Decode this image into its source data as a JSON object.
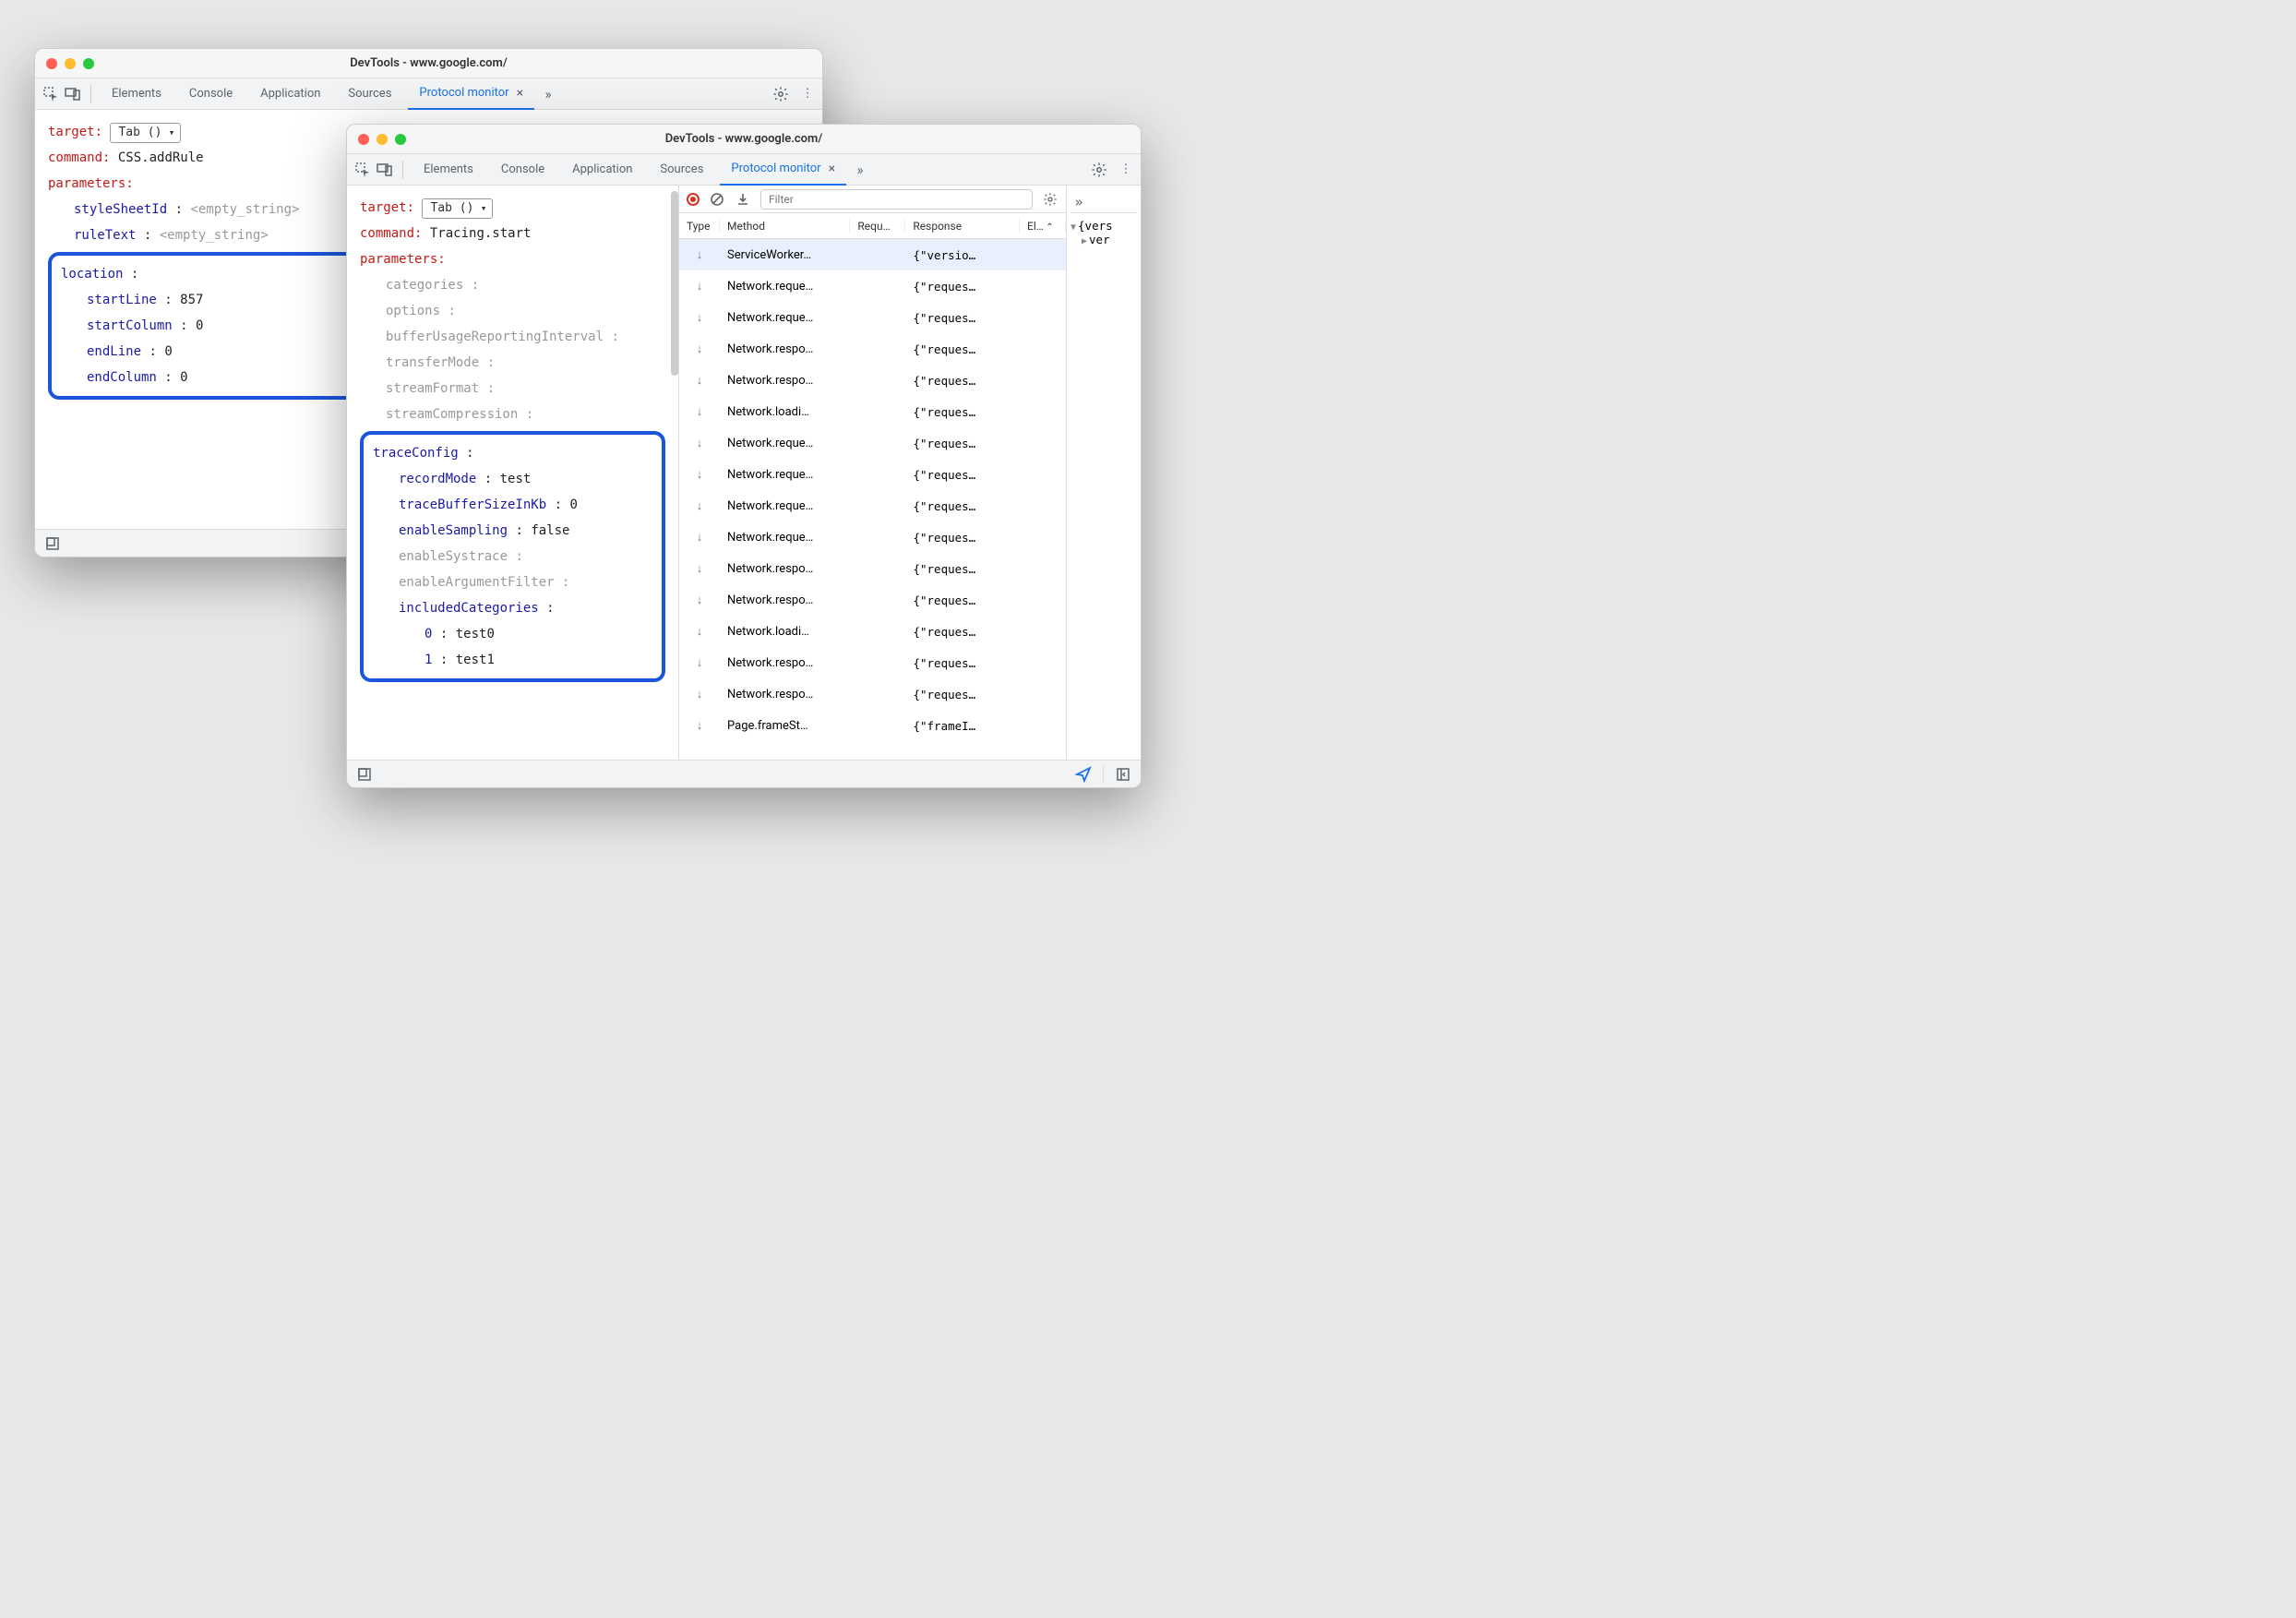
{
  "window_title": "DevTools - www.google.com/",
  "tabs": [
    "Elements",
    "Console",
    "Application",
    "Sources",
    "Protocol monitor"
  ],
  "active_tab": "Protocol monitor",
  "filter_placeholder": "Filter",
  "columns": {
    "type": "Type",
    "method": "Method",
    "request": "Requ…",
    "response": "Response",
    "elapsed": "El…"
  },
  "detail_tree": {
    "root": "{vers",
    "child": "ver"
  },
  "w1": {
    "target_label": "target:",
    "target_value": "Tab ()",
    "command_label": "command:",
    "command_value": "CSS.addRule",
    "parameters_label": "parameters:",
    "params_flat": [
      {
        "name": "styleSheetId",
        "value": "<empty_string>",
        "gray": true
      },
      {
        "name": "ruleText",
        "value": "<empty_string>",
        "gray": true
      }
    ],
    "highlight": {
      "name": "location",
      "items": [
        {
          "name": "startLine",
          "value": "857"
        },
        {
          "name": "startColumn",
          "value": "0"
        },
        {
          "name": "endLine",
          "value": "0"
        },
        {
          "name": "endColumn",
          "value": "0"
        }
      ]
    }
  },
  "w2": {
    "target_label": "target:",
    "target_value": "Tab ()",
    "command_label": "command:",
    "command_value": "Tracing.start",
    "parameters_label": "parameters:",
    "params_flat": [
      {
        "name": "categories",
        "value": ""
      },
      {
        "name": "options",
        "value": ""
      },
      {
        "name": "bufferUsageReportingInterval",
        "value": ""
      },
      {
        "name": "transferMode",
        "value": ""
      },
      {
        "name": "streamFormat",
        "value": ""
      },
      {
        "name": "streamCompression",
        "value": ""
      }
    ],
    "highlight": {
      "name": "traceConfig",
      "items": [
        {
          "name": "recordMode",
          "value": "test"
        },
        {
          "name": "traceBufferSizeInKb",
          "value": "0"
        },
        {
          "name": "enableSampling",
          "value": "false"
        },
        {
          "name": "enableSystrace",
          "value": "",
          "gray": true
        },
        {
          "name": "enableArgumentFilter",
          "value": "",
          "gray": true
        },
        {
          "name": "includedCategories",
          "value": "",
          "haschildren": true
        }
      ],
      "array_items": [
        {
          "idx": "0",
          "value": "test0"
        },
        {
          "idx": "1",
          "value": "test1"
        }
      ]
    }
  },
  "rows": [
    {
      "method": "ServiceWorker…",
      "response": "{\"versio…",
      "selected": true
    },
    {
      "method": "Network.reque…",
      "response": "{\"reques…"
    },
    {
      "method": "Network.reque…",
      "response": "{\"reques…"
    },
    {
      "method": "Network.respo…",
      "response": "{\"reques…"
    },
    {
      "method": "Network.respo…",
      "response": "{\"reques…"
    },
    {
      "method": "Network.loadi…",
      "response": "{\"reques…"
    },
    {
      "method": "Network.reque…",
      "response": "{\"reques…"
    },
    {
      "method": "Network.reque…",
      "response": "{\"reques…"
    },
    {
      "method": "Network.reque…",
      "response": "{\"reques…"
    },
    {
      "method": "Network.reque…",
      "response": "{\"reques…"
    },
    {
      "method": "Network.respo…",
      "response": "{\"reques…"
    },
    {
      "method": "Network.respo…",
      "response": "{\"reques…"
    },
    {
      "method": "Network.loadi…",
      "response": "{\"reques…"
    },
    {
      "method": "Network.respo…",
      "response": "{\"reques…"
    },
    {
      "method": "Network.respo…",
      "response": "{\"reques…"
    },
    {
      "method": "Page.frameSt…",
      "response": "{\"frameI…"
    }
  ]
}
